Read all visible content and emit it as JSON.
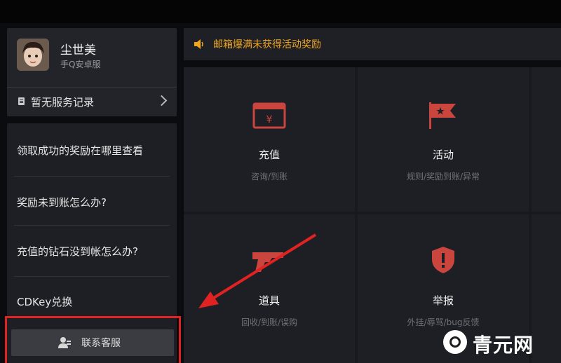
{
  "profile": {
    "username": "尘世美",
    "server": "手Q安卓服",
    "service_record": "暂无服务记录"
  },
  "faq": {
    "items": [
      "领取成功的奖励在哪里查看",
      "奖励未到账怎么办?",
      "充值的钻石没到帐怎么办?",
      "CDKey兑换"
    ],
    "contact_label": "联系客服"
  },
  "notice": {
    "text": "邮箱爆满未获得活动奖励"
  },
  "categories": [
    {
      "title": "充值",
      "subtitle": "咨询/到账",
      "icon": "wallet-icon"
    },
    {
      "title": "活动",
      "subtitle": "规则/奖励到账/异常",
      "icon": "flag-icon"
    },
    {
      "title": "道具",
      "subtitle": "回收/到账/误购",
      "icon": "gun-icon"
    },
    {
      "title": "举报",
      "subtitle": "外挂/辱骂/bug反馈",
      "icon": "shield-icon"
    }
  ],
  "watermark": {
    "text": "青元网"
  },
  "colors": {
    "accent_orange": "#f0a51f",
    "icon_red": "#c9453e",
    "highlight_red": "#e02222"
  }
}
